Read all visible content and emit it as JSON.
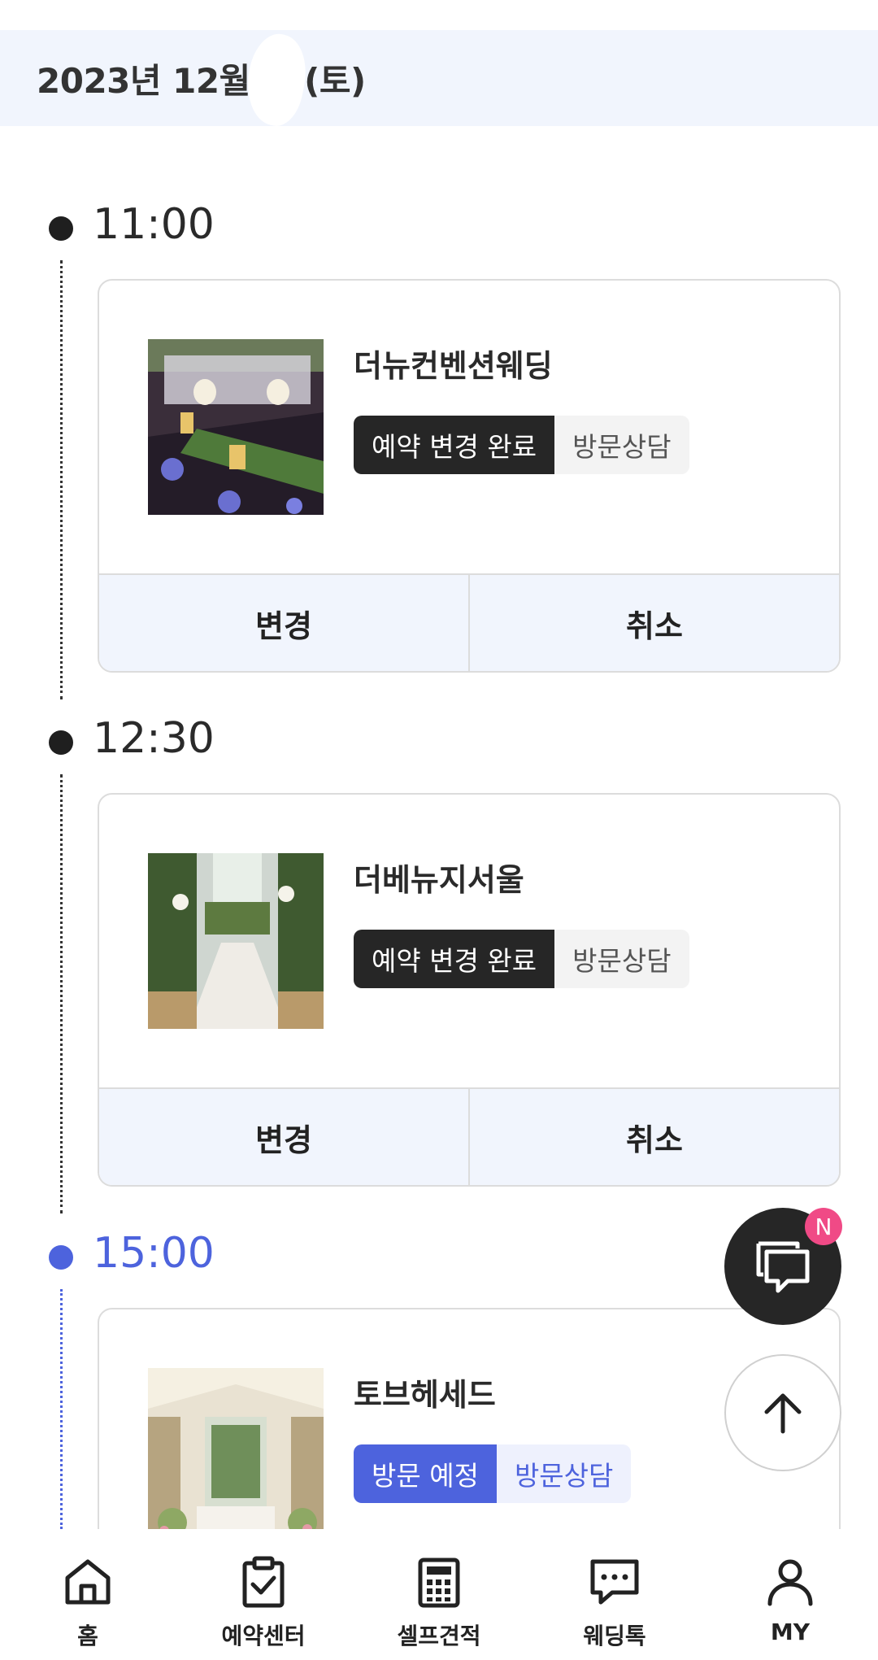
{
  "header": {
    "date": "2023년 12월 일 (토)"
  },
  "colors": {
    "accent": "#4d63dd",
    "dark": "#262626",
    "header_bg": "#f1f5fd",
    "notify": "#f04a86"
  },
  "slots": [
    {
      "time": "11:00",
      "venue": "더뉴컨벤션웨딩",
      "status": "예약 변경 완료",
      "type": "방문상담",
      "change": "변경",
      "cancel": "취소"
    },
    {
      "time": "12:30",
      "venue": "더베뉴지서울",
      "status": "예약 변경 완료",
      "type": "방문상담",
      "change": "변경",
      "cancel": "취소"
    },
    {
      "time": "15:00",
      "venue": "토브헤세드",
      "status": "방문 예정",
      "type": "방문상담"
    }
  ],
  "fab": {
    "badge": "N"
  },
  "nav": [
    {
      "label": "홈",
      "icon": "home-icon"
    },
    {
      "label": "예약센터",
      "icon": "clipboard-check-icon"
    },
    {
      "label": "셀프견적",
      "icon": "calculator-icon"
    },
    {
      "label": "웨딩톡",
      "icon": "chat-bubble-icon"
    },
    {
      "label": "MY",
      "icon": "user-icon"
    }
  ]
}
